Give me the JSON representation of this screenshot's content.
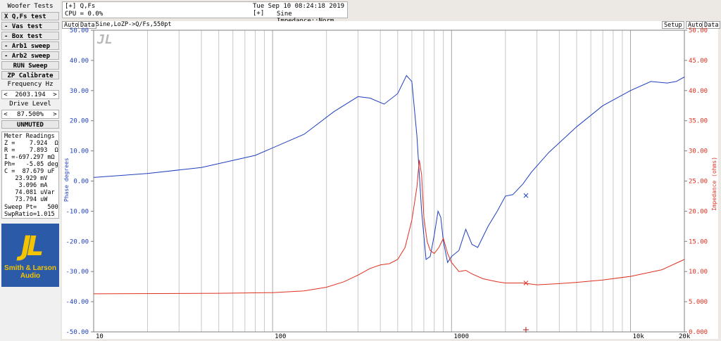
{
  "sidebar": {
    "title": "Woofer Tests",
    "tests": [
      {
        "label": "X Q,Fs test"
      },
      {
        "label": "- Vas test"
      },
      {
        "label": "- Box test"
      },
      {
        "label": "- Arb1 sweep"
      },
      {
        "label": "- Arb2 sweep"
      }
    ],
    "run_label": "RUN Sweep",
    "zp_label": "ZP Calibrate",
    "freq_title": "Frequency Hz",
    "freq_value": "2603.194",
    "drive_title": "Drive Level",
    "drive_value": "87.500%",
    "mute_label": "UNMUTED",
    "left_arrow": "<",
    "right_arrow": ">"
  },
  "meter": {
    "title": "Meter Readings",
    "lines": [
      "Z =    7.924  Ω",
      "R =    7.893  Ω",
      "I =-697.297 mΩ",
      "Ph=   -5.05 deg",
      "C =  87.679 uF",
      "   23.929 mV",
      "    3.096 mA",
      "   74.081 uVar",
      "   73.794 uW"
    ],
    "sweep_pt": "Sweep Pt=   500",
    "swp_ratio": "SwpRatio=1.015"
  },
  "logo": {
    "line1": "Smith & Larson",
    "line2": "Audio"
  },
  "header": {
    "title": "[+] Q,Fs",
    "cpu": "CPU = 0.0%",
    "datetime": "Tue Sep 10 08:24:18 2019 [+]",
    "impedance": "Sine Impedance::Norm"
  },
  "plot_toolbar": {
    "auto": "Auto",
    "data": "Data",
    "title": "Sine,LoZP->Q/Fs,550pt",
    "setup": "Setup"
  },
  "colors": {
    "phase": "#1f3fbf",
    "impedance": "#e03020",
    "grid": "#c8c8c8"
  },
  "chart_data": {
    "type": "line",
    "x_scale": "log",
    "xlim": [
      10,
      20000
    ],
    "x_ticks": [
      "10",
      "100",
      "1000",
      "10k",
      "20k"
    ],
    "ylabel_left": "Phase degrees",
    "ylim_left": [
      -50,
      50
    ],
    "y_ticks_left": [
      "50.00",
      "40.00",
      "30.00",
      "20.00",
      "10.00",
      "0.00",
      "-10.00",
      "-20.00",
      "-30.00",
      "-40.00",
      "-50.00"
    ],
    "ylabel_right": "Impedance (ohms)",
    "ylim_right": [
      0,
      50
    ],
    "y_ticks_right": [
      "50.00",
      "45.00",
      "40.00",
      "35.00",
      "30.00",
      "25.00",
      "20.00",
      "15.00",
      "10.00",
      "5.000",
      "0.000"
    ],
    "series": [
      {
        "axis": "left",
        "x": [
          10,
          20,
          40,
          80,
          150,
          220,
          300,
          350,
          420,
          500,
          560,
          600,
          640,
          680,
          720,
          760,
          800,
          840,
          870,
          900,
          950,
          1000,
          1100,
          1200,
          1300,
          1400,
          1600,
          1800,
          2000,
          2200,
          2500,
          2800,
          3500,
          5000,
          7000,
          10000,
          13000,
          16000,
          18000,
          20000
        ],
        "y": [
          1.2,
          2.5,
          4.5,
          8.5,
          15.5,
          23,
          28,
          27.5,
          25.5,
          29,
          35,
          33,
          15,
          -10,
          -26,
          -25,
          -18,
          -10,
          -12,
          -20,
          -27,
          -25,
          -23,
          -16,
          -21,
          -22,
          -15,
          -10,
          -5,
          -4.5,
          -1,
          3,
          9.5,
          18,
          25,
          30,
          33,
          32.5,
          33,
          34.5
        ]
      },
      {
        "axis": "right",
        "x": [
          10,
          50,
          100,
          150,
          200,
          250,
          300,
          350,
          400,
          450,
          500,
          550,
          600,
          640,
          660,
          680,
          700,
          730,
          760,
          800,
          850,
          900,
          950,
          1000,
          1100,
          1200,
          1300,
          1500,
          1800,
          2000,
          2500,
          3000,
          4000,
          5000,
          7000,
          10000,
          15000,
          20000
        ],
        "y": [
          6.3,
          6.4,
          6.5,
          6.8,
          7.4,
          8.3,
          9.4,
          10.5,
          11.1,
          11.3,
          12.0,
          14.0,
          18.5,
          24.0,
          28.5,
          26.0,
          19.0,
          15.0,
          13.5,
          13.0,
          14.0,
          15.5,
          13.0,
          11.5,
          10.0,
          10.2,
          9.6,
          8.8,
          8.3,
          8.1,
          8.1,
          7.8,
          8.0,
          8.2,
          8.6,
          9.2,
          10.3,
          12.0
        ]
      }
    ]
  }
}
